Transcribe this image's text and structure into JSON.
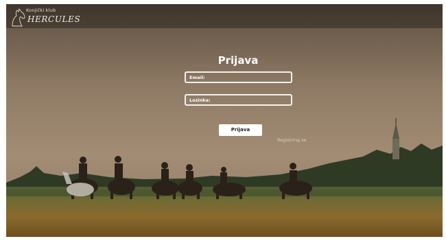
{
  "header": {
    "logo_subtitle": "Konjički klub",
    "logo_title": "HERCULES"
  },
  "login": {
    "title": "Prijava",
    "email_label": "Email:",
    "password_label": "Lozinka:",
    "submit_label": "Prijava",
    "register_link": "Registriraj se"
  },
  "colors": {
    "topbar": "#3f362c",
    "text": "#ffffff",
    "button_bg": "#ffffff"
  },
  "icons": {
    "logo": "horse-head-icon"
  }
}
